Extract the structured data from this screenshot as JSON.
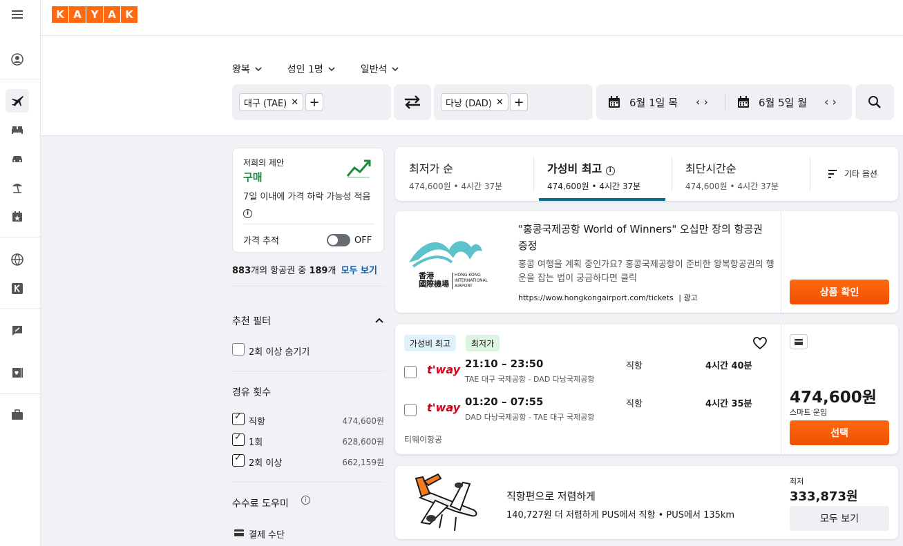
{
  "logo": {
    "letters": [
      "K",
      "A",
      "Y",
      "A",
      "K"
    ]
  },
  "search": {
    "trip_type": "왕복",
    "travelers": "성인 1명",
    "cabin": "일반석",
    "origin": "대구 (TAE)",
    "destination": "다낭 (DAD)",
    "depart_date": "6월 1일 목",
    "return_date": "6월 5일 월"
  },
  "advice": {
    "title": "저희의 제안",
    "verdict": "구매",
    "desc": "7일 이내에 가격 하락 가능성 적음",
    "tracking_label": "가격 추적",
    "toggle_state": "OFF"
  },
  "result_count": {
    "shown": "883",
    "mid": "개의 항공권 중 ",
    "total": "189",
    "suffix": "개",
    "link": "모두 보기"
  },
  "filters": {
    "recommended_title": "추천 필터",
    "hide_two_plus": "2회 이상 숨기기",
    "stops_title": "경유 횟수",
    "stops": [
      {
        "label": "직항",
        "price": "474,600원"
      },
      {
        "label": "1회",
        "price": "628,600원"
      },
      {
        "label": "2회 이상",
        "price": "662,159원"
      }
    ],
    "fee_title": "수수료 도우미",
    "payment_label": "결제 수단"
  },
  "sort_tabs": [
    {
      "title": "최저가 순",
      "sub": "474,600원 • 4시간 37분"
    },
    {
      "title": "가성비 최고",
      "sub": "474,600원 • 4시간 37분"
    },
    {
      "title": "최단시간순",
      "sub": "474,600원 • 4시간 37분"
    }
  ],
  "more_options": "기타 옵션",
  "ad": {
    "logo_cn": "香港\n國際機場",
    "logo_en": "HONG KONG\nINTERNATIONAL\nAIRPORT",
    "title": "\"홍콩국제공항 World of Winners\" 오십만 장의 항공권 증정",
    "desc": "홍콩 여행을 계획 중인가요? 홍콩국제공항이 준비한 왕복항공권의 행운을 잡는 법이 궁금하다면 클릭",
    "url": "https://wow.hongkongairport.com/tickets",
    "ad_label": "광고",
    "cta": "상품 확인"
  },
  "flight": {
    "badges": [
      "가성비 최고",
      "최저가"
    ],
    "airline_logo": "t'way",
    "legs": [
      {
        "times": "21:10 – 23:50",
        "route": "TAE 대구 국제공항 - DAD 다낭국제공항",
        "stops": "직항",
        "duration": "4시간 40분"
      },
      {
        "times": "01:20 – 07:55",
        "route": "DAD 다낭국제공항 - TAE 대구 국제공항",
        "stops": "직항",
        "duration": "4시간 35분"
      }
    ],
    "airline": "티웨이항공",
    "price": "474,600원",
    "fare": "스마트 운임",
    "select": "선택"
  },
  "promo": {
    "title": "직항편으로 저렴하게",
    "desc": "140,727원 더 저렴하게 PUS에서 직항 • PUS에서 135km",
    "min_label": "최저",
    "price": "333,873원",
    "cta": "모두 보기"
  },
  "colors": {
    "brand": "#ff690f",
    "cta": "#ff5a00",
    "buy": "#1d8a3a",
    "link": "#0b5cab",
    "tab_active": "#0b6e8c"
  }
}
